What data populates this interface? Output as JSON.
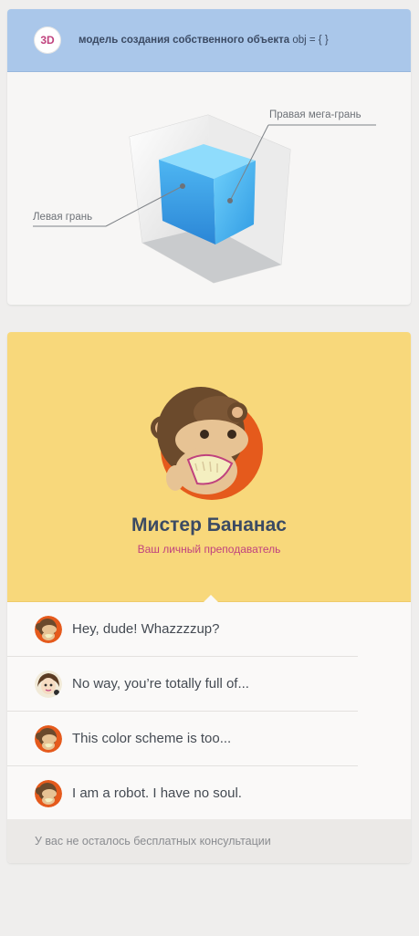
{
  "model_card": {
    "badge": "3D",
    "title": "модель создания собственного объекта",
    "title_code": "obj = { }",
    "label_right": "Правая мега-грань",
    "label_left": "Левая грань"
  },
  "tutor_card": {
    "name": "Мистер Бананас",
    "subtitle": "Ваш личный преподаватель",
    "messages": [
      {
        "avatar": "monkey-avatar-icon",
        "text": "Hey, dude! Whazzzzup?"
      },
      {
        "avatar": "girl-avatar-icon",
        "text": "No way, you’re totally full of..."
      },
      {
        "avatar": "monkey-avatar-icon",
        "text": "This color scheme is too..."
      },
      {
        "avatar": "monkey-avatar-icon",
        "text": "I am a robot. I have no soul."
      }
    ],
    "footer": "У вас не осталось бесплатных консультации"
  },
  "colors": {
    "header_blue": "#aac7ea",
    "accent_pink": "#c0427e",
    "card_yellow": "#f8d87b",
    "title_navy": "#3b4a63",
    "monkey_orange": "#e55a1c"
  }
}
